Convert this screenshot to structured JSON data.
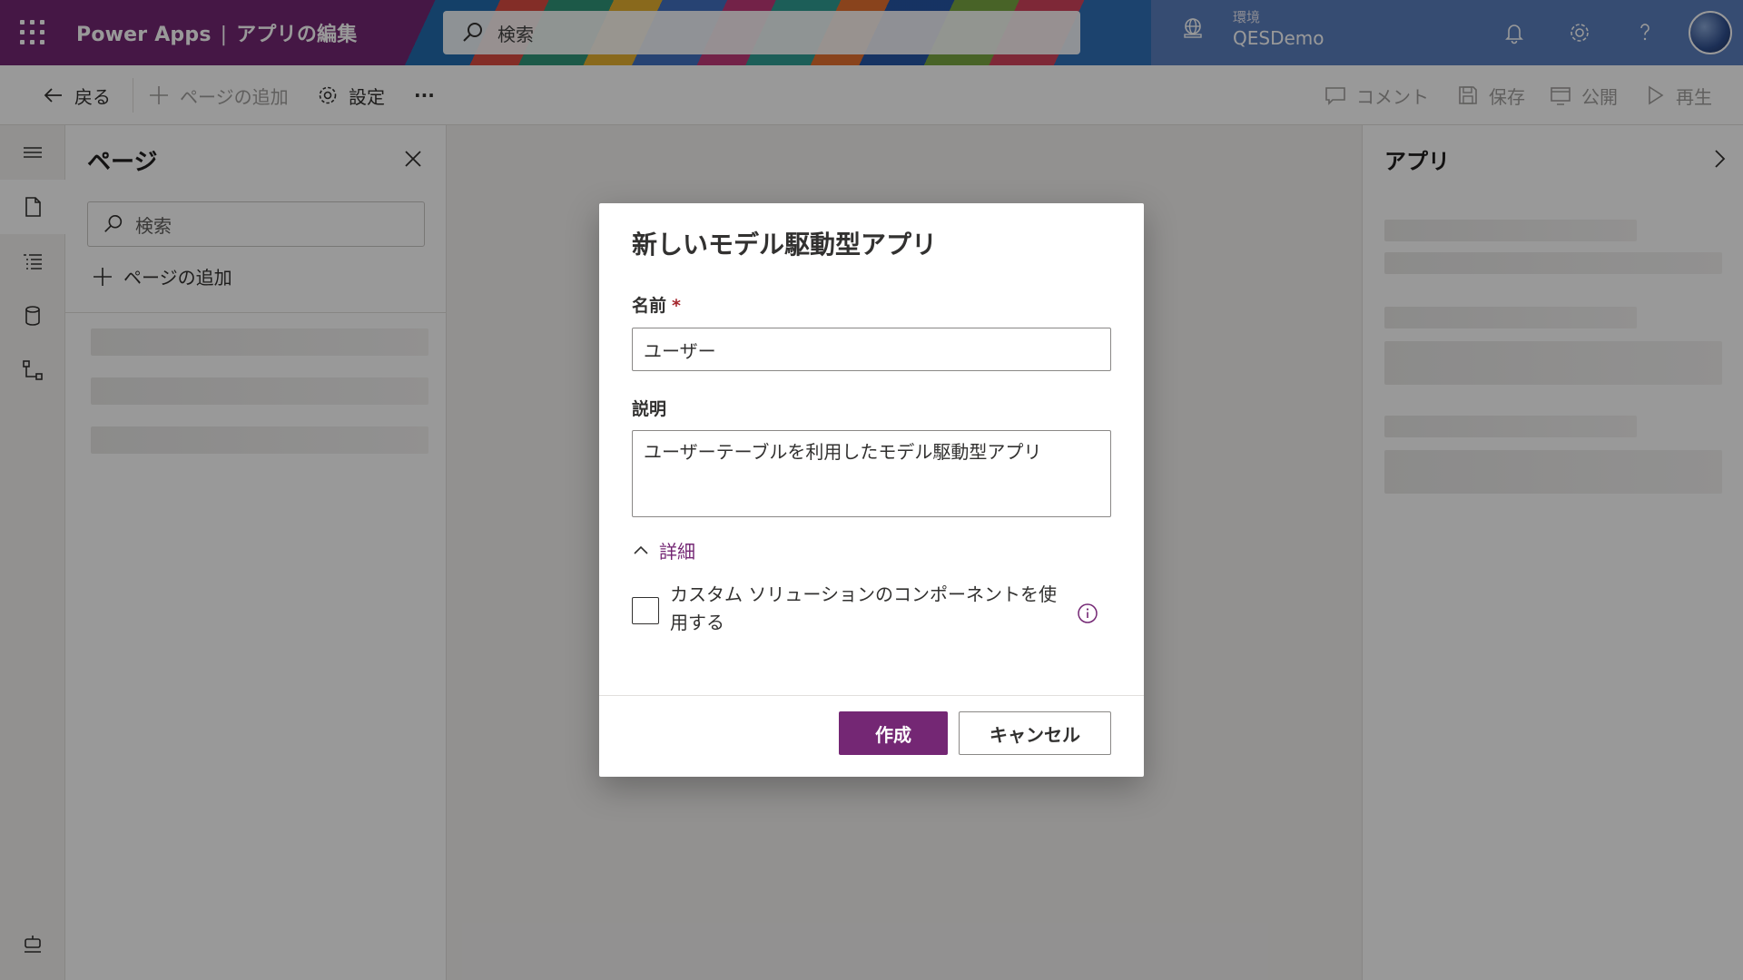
{
  "header": {
    "app_name": "Power Apps",
    "separator": "|",
    "page_name": "アプリの編集",
    "search_placeholder": "検索",
    "environment_label": "環境",
    "environment_name": "QESDemo"
  },
  "commandbar": {
    "back": "戻る",
    "add_page": "ページの追加",
    "settings": "設定",
    "more": "···",
    "comment": "コメント",
    "save": "保存",
    "publish": "公開",
    "play": "再生"
  },
  "pages_panel": {
    "title": "ページ",
    "search_placeholder": "検索",
    "add_page": "ページの追加"
  },
  "right_panel": {
    "title": "アプリ"
  },
  "dialog": {
    "title": "新しいモデル駆動型アプリ",
    "name_label": "名前",
    "required_mark": "*",
    "name_value": "ユーザー",
    "description_label": "説明",
    "description_value": "ユーザーテーブルを利用したモデル駆動型アプリ",
    "details_toggle": "詳細",
    "checkbox_label": "カスタム ソリューションのコンポーネントを使用する",
    "checkbox_checked": false,
    "create_button": "作成",
    "cancel_button": "キャンセル"
  },
  "colors": {
    "brand": "#742774",
    "required": "#a4262c"
  }
}
